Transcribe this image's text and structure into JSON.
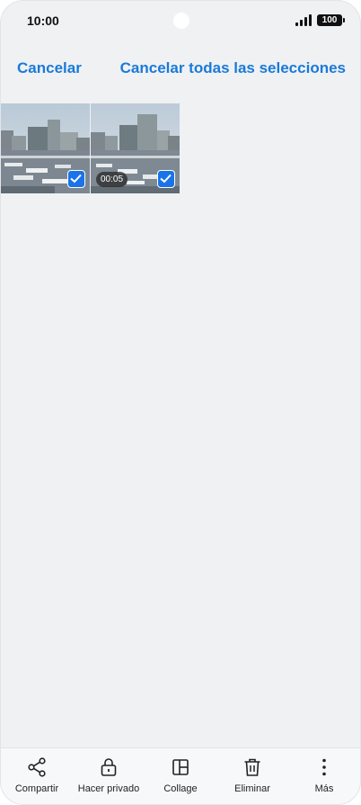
{
  "status": {
    "time": "10:00",
    "battery": "100"
  },
  "header": {
    "cancel_label": "Cancelar",
    "cancel_all_label": "Cancelar todas las selecciones"
  },
  "items": [
    {
      "type": "photo",
      "selected": true
    },
    {
      "type": "video",
      "selected": true,
      "duration": "00:05"
    }
  ],
  "toolbar": {
    "share_label": "Compartir",
    "private_label": "Hacer privado",
    "collage_label": "Collage",
    "delete_label": "Eliminar",
    "more_label": "Más"
  },
  "colors": {
    "accent": "#1a7ad8",
    "check": "#1a73e8",
    "background": "#f0f1f3"
  }
}
